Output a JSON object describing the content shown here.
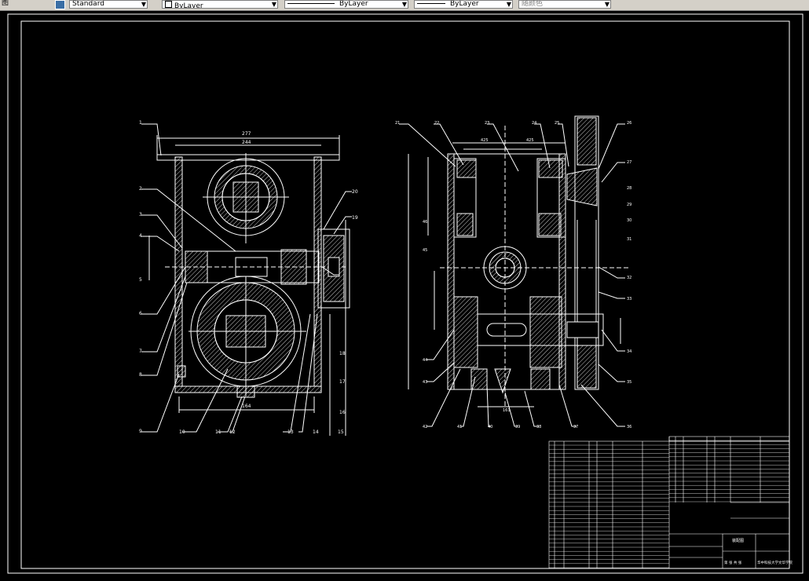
{
  "toolbar": {
    "left_label": "图",
    "text_style": "Standard",
    "layer": "ByLayer",
    "linetype": "ByLayer",
    "lineweight": "ByLayer",
    "plot_style": "随颜色"
  },
  "left_view": {
    "dims": {
      "overall_width": "277",
      "inner_width": "244",
      "bottom_width": "164"
    },
    "balloons": {
      "l1": "1",
      "l2": "2",
      "l3": "3",
      "l4": "4",
      "l5": "5",
      "l6": "6",
      "l7": "7",
      "l8": "8",
      "l9": "9",
      "l10": "10",
      "l11": "11",
      "l12": "12",
      "r13": "13",
      "r14": "14",
      "r15": "15",
      "r16": "16",
      "r17": "17",
      "r18": "18",
      "r19": "19",
      "r20": "20"
    }
  },
  "right_view": {
    "dims": {
      "top_a": "425",
      "top_b": "425",
      "bottom": "161"
    },
    "balloons": {
      "t21": "21",
      "t22": "22",
      "t23": "23",
      "t24": "24",
      "t25": "25",
      "r26": "26",
      "r27": "27",
      "r28": "28",
      "r29": "29",
      "r30": "30",
      "r31": "31",
      "r32": "32",
      "r33": "33",
      "r34": "34",
      "r35": "35",
      "r36": "36",
      "b37": "37",
      "b38": "38",
      "b39": "39",
      "b40": "40",
      "b41": "41",
      "b42": "42",
      "l43": "43",
      "l44": "44",
      "l45": "45",
      "l46": "46"
    }
  },
  "title_block": {
    "sheet_label": "第 张 共 张",
    "school": "华中科技大学文华学院",
    "drawing_name": "装配图"
  }
}
